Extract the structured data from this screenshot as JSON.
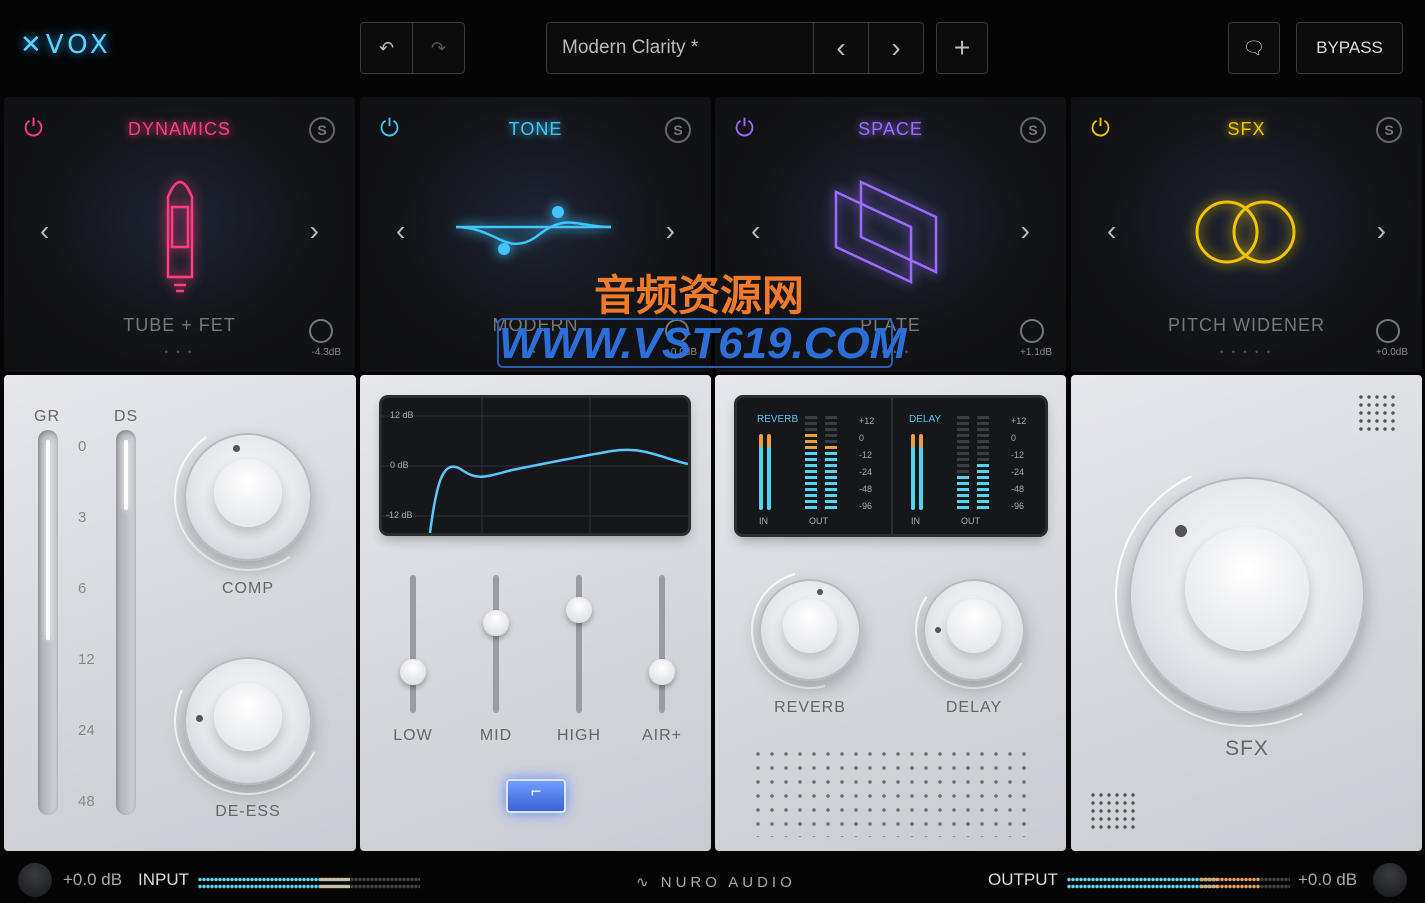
{
  "header": {
    "logo": "VOX",
    "undo_icon": "undo-icon",
    "redo_icon": "redo-icon",
    "preset_name": "Modern Clarity *",
    "prev": "‹",
    "next": "›",
    "add": "+",
    "comment_icon": "comment-icon",
    "bypass": "BYPASS"
  },
  "modules": [
    {
      "title": "DYNAMICS",
      "color": "#ff3d7f",
      "name": "TUBE + FET",
      "gain": "-4.3dB",
      "dots": "• • •"
    },
    {
      "title": "TONE",
      "color": "#3fc6ff",
      "name": "MODERN",
      "gain": "0.0dB",
      "dots": "•"
    },
    {
      "title": "SPACE",
      "color": "#9a6bff",
      "name": "PLATE",
      "gain": "+1.1dB",
      "dots": "• • • •"
    },
    {
      "title": "SFX",
      "color": "#f2c400",
      "name": "PITCH WIDENER",
      "gain": "+0.0dB",
      "dots": "• • • • •"
    }
  ],
  "dynamics": {
    "gr": "GR",
    "ds": "DS",
    "scale": [
      "0",
      "3",
      "6",
      "12",
      "24",
      "48"
    ],
    "comp": "COMP",
    "deess": "DE-ESS"
  },
  "tone": {
    "eq_labels": [
      "12 dB",
      "0 dB",
      "-12 dB"
    ],
    "faders": [
      {
        "label": "LOW",
        "value": 0.3
      },
      {
        "label": "MID",
        "value": 0.65
      },
      {
        "label": "HIGH",
        "value": 0.75
      },
      {
        "label": "AIR+",
        "value": 0.3
      }
    ]
  },
  "space": {
    "reverb_title": "REVERB",
    "delay_title": "DELAY",
    "scale": [
      "+12",
      "0",
      "-12",
      "-24",
      "-48",
      "-96"
    ],
    "in": "IN",
    "out": "OUT",
    "reverb": "REVERB",
    "delay": "DELAY"
  },
  "sfx": {
    "label": "SFX"
  },
  "footer": {
    "input_db": "+0.0 dB",
    "input": "INPUT",
    "brand": "NURO AUDIO",
    "output": "OUTPUT",
    "output_db": "+0.0 dB"
  },
  "watermark": {
    "cn": "音频资源网",
    "url": "WWW.VST619.COM"
  }
}
